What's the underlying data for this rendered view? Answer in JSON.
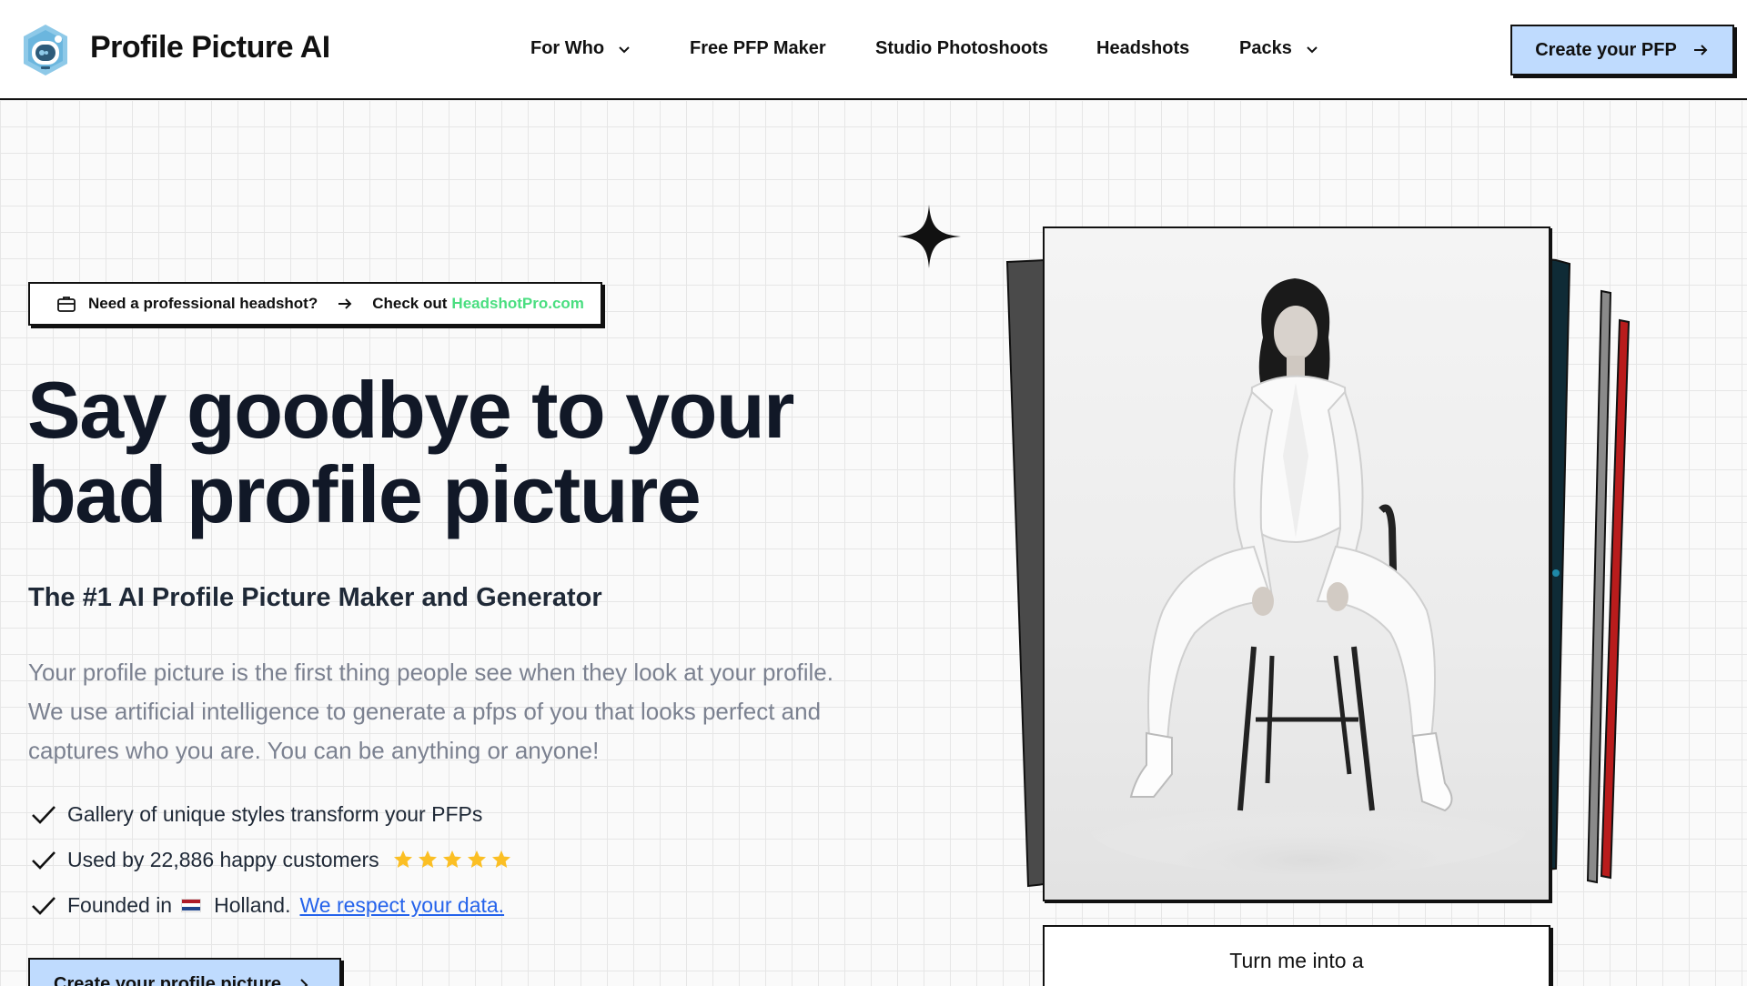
{
  "nav": {
    "brand": "Profile Picture AI",
    "items": [
      {
        "label": "For Who",
        "dropdown": true
      },
      {
        "label": "Free PFP Maker",
        "dropdown": false
      },
      {
        "label": "Studio Photoshoots",
        "dropdown": false
      },
      {
        "label": "Headshots",
        "dropdown": false
      },
      {
        "label": "Packs",
        "dropdown": true
      }
    ],
    "cta": "Create your PFP"
  },
  "promo": {
    "icon": "briefcase-icon",
    "question": "Need a professional headshot?",
    "check_out": "Check out",
    "link": "HeadshotPro.com",
    "link_color": "#4ade80"
  },
  "hero": {
    "headline_line1": "Say goodbye to your",
    "headline_line2": "bad profile picture",
    "subhead": "The #1 AI Profile Picture Maker and Generator",
    "paragraph": "Your profile picture is the first thing people see when they look at your profile. We use artificial intelligence to generate a pfps of you that looks perfect and captures who you are. You can be anything or anyone!",
    "bullets": {
      "gallery": "Gallery of unique styles transform your PFPs",
      "used_by": "Used by 22,886 happy customers",
      "rating_stars": 5,
      "founded_prefix": "Founded in",
      "founded_country": "Holland.",
      "data_link": "We respect your data."
    },
    "cta": "Create your profile picture"
  },
  "visual": {
    "caption": "Turn me into a"
  },
  "colors": {
    "accent_blue": "#bfdbfe",
    "link_blue": "#2563eb",
    "star": "#fbbf24"
  }
}
